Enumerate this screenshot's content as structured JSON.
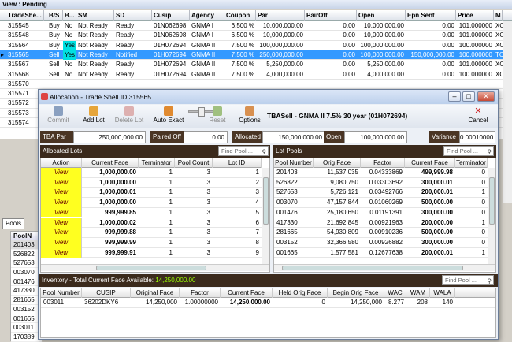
{
  "view_title": "View : Pending",
  "columns": [
    "TradeShe...",
    "B/S",
    "B...",
    "SM",
    "SD",
    "Cusip",
    "Agency",
    "Coupon",
    "Par",
    "PairOff",
    "Open",
    "Epn Sent",
    "Price",
    "M"
  ],
  "rows": [
    {
      "id": "315545",
      "bs": "Buy",
      "b": "No",
      "sm": "Not Ready",
      "sd": "Ready",
      "cusip": "01N062698",
      "agency": "GNMA I",
      "coupon": "6.500 %",
      "par": "10,000,000.00",
      "pairoff": "0.00",
      "open": "10,000,000.00",
      "epn": "0.00",
      "price": "101.000000",
      "m": "XO"
    },
    {
      "id": "315548",
      "bs": "Buy",
      "b": "No",
      "sm": "Not Ready",
      "sd": "Ready",
      "cusip": "01N062698",
      "agency": "GNMA I",
      "coupon": "6.500 %",
      "par": "10,000,000.00",
      "pairoff": "0.00",
      "open": "10,000,000.00",
      "epn": "0.00",
      "price": "101.000000",
      "m": "XO"
    },
    {
      "id": "315564",
      "bs": "Buy",
      "b": "Yes",
      "sm": "Not Ready",
      "sd": "Ready",
      "cusip": "01H072694",
      "agency": "GNMA II",
      "coupon": "7.500 %",
      "par": "100,000,000.00",
      "pairoff": "0.00",
      "open": "100,000,000.00",
      "epn": "0.00",
      "price": "100.000000",
      "m": "XO"
    },
    {
      "id": "315565",
      "bs": "Sell",
      "b": "Yes",
      "sm": "Not Ready",
      "sd": "Notified",
      "cusip": "01H072694",
      "agency": "GNMA II",
      "coupon": "7.500 %",
      "par": "250,000,000.00",
      "pairoff": "0.00",
      "open": "100,000,000.00",
      "epn": "150,000,000.00",
      "price": "100.000000",
      "m": "TC"
    },
    {
      "id": "315567",
      "bs": "Sell",
      "b": "No",
      "sm": "Not Ready",
      "sd": "Ready",
      "cusip": "01H072694",
      "agency": "GNMA II",
      "coupon": "7.500 %",
      "par": "5,250,000.00",
      "pairoff": "0.00",
      "open": "5,250,000.00",
      "epn": "0.00",
      "price": "101.000000",
      "m": "XO"
    },
    {
      "id": "315568",
      "bs": "Sell",
      "b": "No",
      "sm": "Not Ready",
      "sd": "Ready",
      "cusip": "01H072694",
      "agency": "GNMA II",
      "coupon": "7.500 %",
      "par": "4,000,000.00",
      "pairoff": "0.00",
      "open": "4,000,000.00",
      "epn": "0.00",
      "price": "100.000000",
      "m": "XO"
    },
    {
      "id": "315570",
      "bs": "",
      "b": "",
      "sm": "",
      "sd": "",
      "cusip": "",
      "agency": "",
      "coupon": "",
      "par": "",
      "pairoff": "",
      "open": "",
      "epn": "",
      "price": "",
      "m": ""
    },
    {
      "id": "315571",
      "bs": "",
      "b": "",
      "sm": "",
      "sd": "",
      "cusip": "",
      "agency": "",
      "coupon": "",
      "par": "",
      "pairoff": "",
      "open": "",
      "epn": "",
      "price": "",
      "m": ""
    },
    {
      "id": "315572",
      "bs": "",
      "b": "",
      "sm": "",
      "sd": "",
      "cusip": "",
      "agency": "",
      "coupon": "",
      "par": "",
      "pairoff": "",
      "open": "",
      "epn": "",
      "price": "",
      "m": ""
    },
    {
      "id": "315573",
      "bs": "",
      "b": "",
      "sm": "",
      "sd": "",
      "cusip": "",
      "agency": "",
      "coupon": "",
      "par": "",
      "pairoff": "",
      "open": "",
      "epn": "",
      "price": "",
      "m": ""
    },
    {
      "id": "315574",
      "bs": "",
      "b": "",
      "sm": "",
      "sd": "",
      "cusip": "",
      "agency": "",
      "coupon": "",
      "par": "",
      "pairoff": "",
      "open": "",
      "epn": "",
      "price": "",
      "m": ""
    }
  ],
  "pools_tab": "Pools",
  "pools_header": "PoolN",
  "pools_list": [
    "201403",
    "526822",
    "527653",
    "003070",
    "001476",
    "417330",
    "281665",
    "003152",
    "001665",
    "003011",
    "170389"
  ],
  "dialog": {
    "title": "Allocation - Trade Shell ID 315565",
    "tbasell": "TBASell - GNMA II  7.5%  30 year  (01H072694)",
    "toolbar": {
      "commit": "Commit",
      "add_lot": "Add Lot",
      "delete_lot": "Delete Lot",
      "auto_exact": "Auto Exact",
      "reset": "Reset",
      "options": "Options",
      "cancel": "Cancel"
    },
    "summary": {
      "tba_par_label": "TBA Par",
      "tba_par": "250,000,000.00",
      "paired_off_label": "Paired Off",
      "paired_off": "0.00",
      "allocated_label": "Allocated",
      "allocated": "150,000,000.00",
      "open_label": "Open",
      "open": "100,000,000.00",
      "variance_label": "Variance",
      "variance": "0.00010000"
    },
    "allocated_lots": {
      "title": "Allocated Lots",
      "find_placeholder": "Find Pool ...",
      "columns": [
        "Action",
        "Current Face",
        "Terminator",
        "Pool Count",
        "Lot ID"
      ],
      "rows": [
        {
          "action": "View",
          "face": "1,000,000.00",
          "term": "1",
          "count": "3",
          "lot": "1"
        },
        {
          "action": "View",
          "face": "1,000,000.00",
          "term": "1",
          "count": "3",
          "lot": "2"
        },
        {
          "action": "View",
          "face": "1,000,000.01",
          "term": "1",
          "count": "3",
          "lot": "3"
        },
        {
          "action": "View",
          "face": "1,000,000.00",
          "term": "1",
          "count": "3",
          "lot": "4"
        },
        {
          "action": "View",
          "face": "999,999.85",
          "term": "1",
          "count": "3",
          "lot": "5"
        },
        {
          "action": "View",
          "face": "1,000,000.02",
          "term": "1",
          "count": "3",
          "lot": "6"
        },
        {
          "action": "View",
          "face": "999,999.88",
          "term": "1",
          "count": "3",
          "lot": "7"
        },
        {
          "action": "View",
          "face": "999,999.99",
          "term": "1",
          "count": "3",
          "lot": "8"
        },
        {
          "action": "View",
          "face": "999,999.91",
          "term": "1",
          "count": "3",
          "lot": "9"
        }
      ]
    },
    "lot_pools": {
      "title": "Lot Pools",
      "find_placeholder": "Find Pool ...",
      "columns": [
        "Pool Number",
        "Orig Face",
        "Factor",
        "Current Face",
        "Terminator"
      ],
      "rows": [
        {
          "pool": "201403",
          "orig": "11,537,035",
          "factor": "0.04333869",
          "face": "499,999.98",
          "term": "0"
        },
        {
          "pool": "526822",
          "orig": "9,080,750",
          "factor": "0.03303692",
          "face": "300,000.01",
          "term": "0"
        },
        {
          "pool": "527653",
          "orig": "5,726,121",
          "factor": "0.03492766",
          "face": "200,000.01",
          "term": "1"
        },
        {
          "pool": "003070",
          "orig": "47,157,844",
          "factor": "0.01060269",
          "face": "500,000.00",
          "term": "0"
        },
        {
          "pool": "001476",
          "orig": "25,180,650",
          "factor": "0.01191391",
          "face": "300,000.00",
          "term": "0"
        },
        {
          "pool": "417330",
          "orig": "21,692,845",
          "factor": "0.00921963",
          "face": "200,000.00",
          "term": "1"
        },
        {
          "pool": "281665",
          "orig": "54,930,809",
          "factor": "0.00910236",
          "face": "500,000.00",
          "term": "0"
        },
        {
          "pool": "003152",
          "orig": "32,366,580",
          "factor": "0.00926882",
          "face": "300,000.00",
          "term": "0"
        },
        {
          "pool": "001665",
          "orig": "1,577,581",
          "factor": "0.12677638",
          "face": "200,000.01",
          "term": "1"
        }
      ]
    },
    "inventory": {
      "label": "Inventory - Total Current Face Available:",
      "total": "14,250,000.00",
      "find_placeholder": "Find Pool ...",
      "columns": [
        "Pool Number",
        "CUSIP",
        "Original Face",
        "Factor",
        "Current Face",
        "Held Orig Face",
        "Begin Orig Face",
        "WAC",
        "WAM",
        "WALA"
      ],
      "rows": [
        {
          "pool": "003011",
          "cusip": "36202DKY6",
          "orig": "14,250,000",
          "factor": "1.00000000",
          "face": "14,250,000.00",
          "held": "0",
          "begin": "14,250,000",
          "wac": "8.277",
          "wam": "208",
          "wala": "140"
        }
      ]
    }
  },
  "colors": {
    "selection": "#3399ff",
    "view_button": "#ffff20",
    "panel_header": "#3b2a1c",
    "available_total": "#99ff00"
  }
}
